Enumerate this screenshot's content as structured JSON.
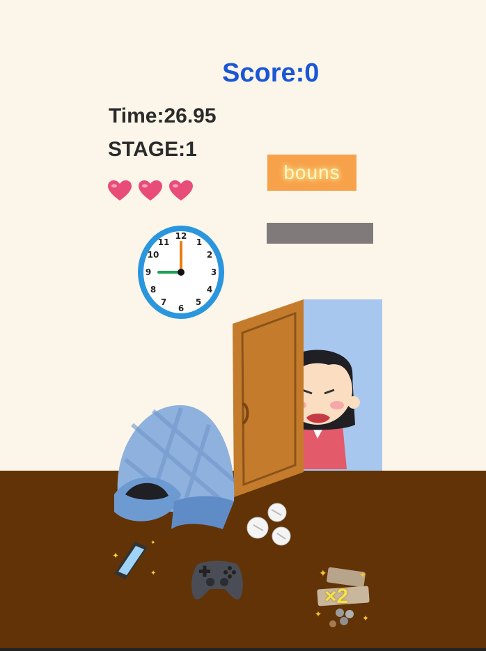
{
  "hud": {
    "score_text": "Score:0",
    "time_text": "Time:26.95",
    "stage_text": "STAGE:1",
    "lives": 3
  },
  "bonus": {
    "label": "bouns",
    "gauge_level": 0
  },
  "items": {
    "money_multiplier": "×2"
  },
  "clock": {
    "numerals": [
      "12",
      "1",
      "2",
      "3",
      "4",
      "5",
      "6",
      "7",
      "8",
      "9",
      "10",
      "11"
    ],
    "hour_hand": 9,
    "minute_hand": 0
  },
  "colors": {
    "wall": "#fbf6e9",
    "floor": "#613306",
    "score": "#1a56d6",
    "bonus_button": "#f7a14a",
    "bonus_bar": "#817a7b",
    "heart": "#e84d7a",
    "clock_ring": "#2a96dd"
  }
}
